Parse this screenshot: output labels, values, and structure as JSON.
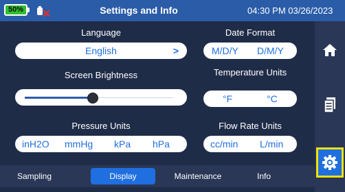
{
  "status_bar": {
    "battery_percent": "50%",
    "title": "Settings and Info",
    "datetime": "04:30 PM 03/26/2023"
  },
  "settings": {
    "language": {
      "label": "Language",
      "value": "English"
    },
    "date_format": {
      "label": "Date Format",
      "options": [
        "M/D/Y",
        "D/M/Y"
      ]
    },
    "brightness": {
      "label": "Screen Brightness",
      "level": 0.4
    },
    "temperature_units": {
      "label": "Temperature Units",
      "options": [
        "°F",
        "°C"
      ]
    },
    "pressure_units": {
      "label": "Pressure Units",
      "options": [
        "inH2O",
        "mmHg",
        "kPa",
        "hPa"
      ]
    },
    "flow_rate_units": {
      "label": "Flow Rate Units",
      "options": [
        "cc/min",
        "L/min"
      ]
    }
  },
  "tabs": [
    {
      "label": "Sampling"
    },
    {
      "label": "Display",
      "active": true
    },
    {
      "label": "Maintenance"
    },
    {
      "label": "Info"
    }
  ],
  "sidebar": {
    "items": [
      {
        "icon": "home-icon"
      },
      {
        "icon": "document-icon"
      },
      {
        "icon": "settings-gear-icon",
        "active": true
      }
    ]
  },
  "colors": {
    "header": "#2b5ca8",
    "accent": "#1f6fe0",
    "background": "#1f2c48",
    "highlight_border": "#f2e200",
    "battery": "#2fbf2f",
    "alert": "#e03030"
  }
}
